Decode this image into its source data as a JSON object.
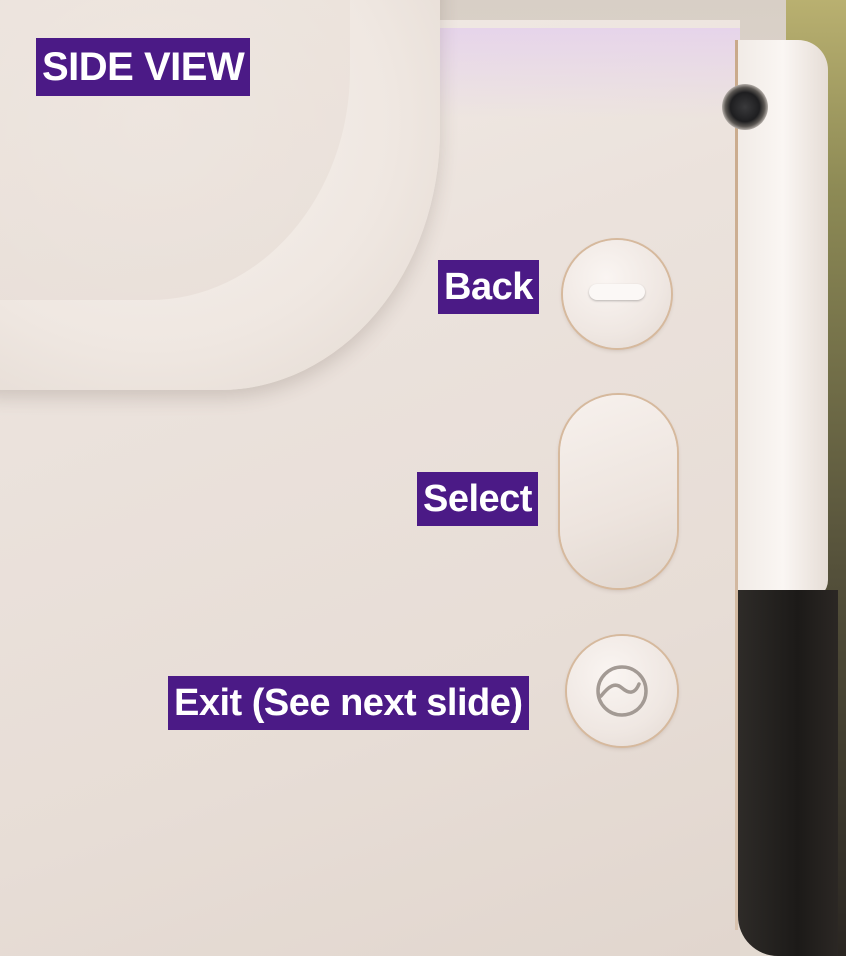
{
  "labels": {
    "side_view": "SIDE VIEW",
    "back": "Back",
    "select": "Select",
    "exit": "Exit (See next slide)"
  },
  "colors": {
    "label_background": "#4b1a86",
    "label_text": "#ffffff",
    "device_body": "#ebe2dc",
    "button_rim": "#d6b99d"
  },
  "icons": {
    "back_button": "dash-icon",
    "select_button": "none",
    "exit_button": "power-swirl-icon"
  }
}
